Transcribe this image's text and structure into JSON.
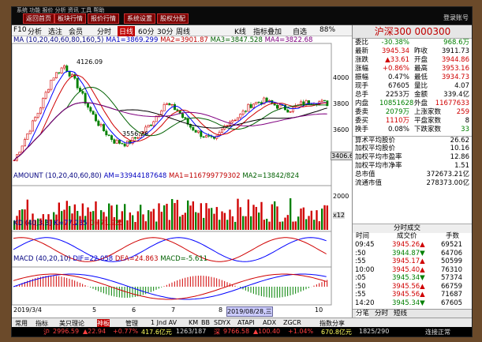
{
  "toolbar": {
    "buttons": [
      "返回首页",
      "板块行情",
      "报价行情",
      "系统设置",
      "股权分配"
    ],
    "menu": "系统 功能 报价 分析 资讯 工具 帮助",
    "right": "登录账号"
  },
  "chart_toolbar": {
    "left_items": [
      "F10",
      "分析",
      "选注",
      "会员"
    ],
    "periods": [
      "分时",
      "日线",
      "60分",
      "30分",
      "周线"
    ],
    "right_items": [
      "K线",
      "指标叠加",
      "自选",
      "88%"
    ]
  },
  "ma_line": {
    "label": "MA",
    "params": "(10,20,40,60,80,160,5)",
    "ma1": "MA1=3869.299",
    "ma2": "MA2=3901.87",
    "ma3": "MA3=3847.528",
    "ma4": "MA4=3822.68"
  },
  "amount_line": {
    "label": "AMOUNT",
    "params": "(10,20,40,60,80)",
    "am": "AM=33944187648",
    "ma1": "MA1=116799779302",
    "ma2": "MA2=13842/824"
  },
  "kd_line": {
    "label": "KD",
    "params": "(40,3,3)",
    "k": "K=77.235",
    "d": "D=71.925"
  },
  "macd_line": {
    "label": "MACD",
    "params": "(40,20,10)",
    "dif": "DIF=22.058",
    "dea": "DEA=24.863",
    "macd": "MACD=-5.611"
  },
  "price_axis": [
    "4000",
    "3800",
    "3600"
  ],
  "annotations": {
    "high": "4126.09",
    "low": "3556.26",
    "last": "3406.61"
  },
  "amount_axis": "2000",
  "amount_unit": "x12",
  "date_axis": {
    "start": "2019/3/4",
    "mid_a": "5",
    "mid_b": "6",
    "mid_c": "7",
    "mid_d": "8",
    "cursor": "2019/08/28,三",
    "end": "10"
  },
  "side": {
    "title": "沪深300",
    "code": "000300",
    "quote": [
      {
        "l": "委比",
        "v": "-30.38%",
        "l2": "",
        "v2": "968.6万",
        "c": "grn",
        "c2": "grn"
      },
      {
        "l": "最新",
        "v": "3945.34",
        "l2": "昨收",
        "v2": "3911.73",
        "c": "red",
        "c2": "blk"
      },
      {
        "l": "涨跌",
        "v": "▲33.61",
        "l2": "开盘",
        "v2": "3944.86",
        "c": "red",
        "c2": "red"
      },
      {
        "l": "涨幅",
        "v": "+0.86%",
        "l2": "最高",
        "v2": "3953.16",
        "c": "red",
        "c2": "red"
      },
      {
        "l": "振幅",
        "v": "0.47%",
        "l2": "最低",
        "v2": "3934.73",
        "c": "blk",
        "c2": "red"
      },
      {
        "l": "现手",
        "v": "67605",
        "l2": "量比",
        "v2": "4.07",
        "c": "blk",
        "c2": "blk"
      },
      {
        "l": "总手",
        "v": "2253万",
        "l2": "金额",
        "v2": "339.4亿",
        "c": "blk",
        "c2": "blk"
      },
      {
        "l": "内盘",
        "v": "10851628",
        "l2": "外盘",
        "v2": "11677633",
        "c": "grn",
        "c2": "red"
      },
      {
        "l": "委卖",
        "v": "2079万",
        "l2": "上涨家数",
        "v2": "259",
        "c": "grn",
        "c2": "red"
      },
      {
        "l": "委买",
        "v": "1110万",
        "l2": "平盘家数",
        "v2": "8",
        "c": "red",
        "c2": "blk"
      },
      {
        "l": "换手",
        "v": "0.08%",
        "l2": "下跌家数",
        "v2": "33",
        "c": "blk",
        "c2": "grn"
      }
    ],
    "stats": [
      {
        "l": "算术平均股价",
        "v": "26.62"
      },
      {
        "l": "加权平均股价",
        "v": "10.16"
      },
      {
        "l": "加权平均市盈率",
        "v": "12.86"
      },
      {
        "l": "加权平均市净率",
        "v": "1.51"
      },
      {
        "l": "总市值",
        "v": "372673.21亿"
      },
      {
        "l": "流通市值",
        "v": "278373.00亿"
      }
    ],
    "ticks_header": {
      "title": "分时成交",
      "c1": "时间",
      "c2": "成交价",
      "c3": "手数"
    },
    "ticks": [
      {
        "t": "09:45",
        "p": "3945.26▲",
        "q": "69521"
      },
      {
        "t": ":50",
        "p": "3944.87▼",
        "q": "64706"
      },
      {
        "t": ":55",
        "p": "3945.17▲",
        "q": "50599"
      },
      {
        "t": "10:00",
        "p": "3945.40▲",
        "q": "76310"
      },
      {
        "t": ":05",
        "p": "3945.34▼",
        "q": "57374"
      },
      {
        "t": ":50",
        "p": "3945.56▲",
        "q": "66759"
      },
      {
        "t": ":55",
        "p": "3945.56▲",
        "q": "71687"
      },
      {
        "t": "14:20",
        "p": "3945.34▼",
        "q": "67605"
      }
    ],
    "tabs": [
      "分笔",
      "分时",
      "短线"
    ]
  },
  "bottom_tabs": [
    "常用",
    "指标",
    "美只理论",
    "神板",
    "管理",
    "1 Jnd AV",
    "KM",
    "BB",
    "SDYX",
    "ATAPI",
    "ADX",
    "ZGCR",
    "指数分享"
  ],
  "status_bar": {
    "idx1_name": "沪",
    "idx1_val": "2996.59",
    "idx1_chg": "▲22.94",
    "idx1_pct": "+0.77%",
    "idx1_amt": "417.6亿元",
    "idx1_cnt": "1263/187",
    "idx2_name": "深",
    "idx2_val": "9766.58",
    "idx2_chg": "▲100.40",
    "idx2_pct": "+1.04%",
    "idx2_amt": "670.8亿元",
    "idx2_cnt": "1825/290",
    "conn": "连接正常"
  }
}
